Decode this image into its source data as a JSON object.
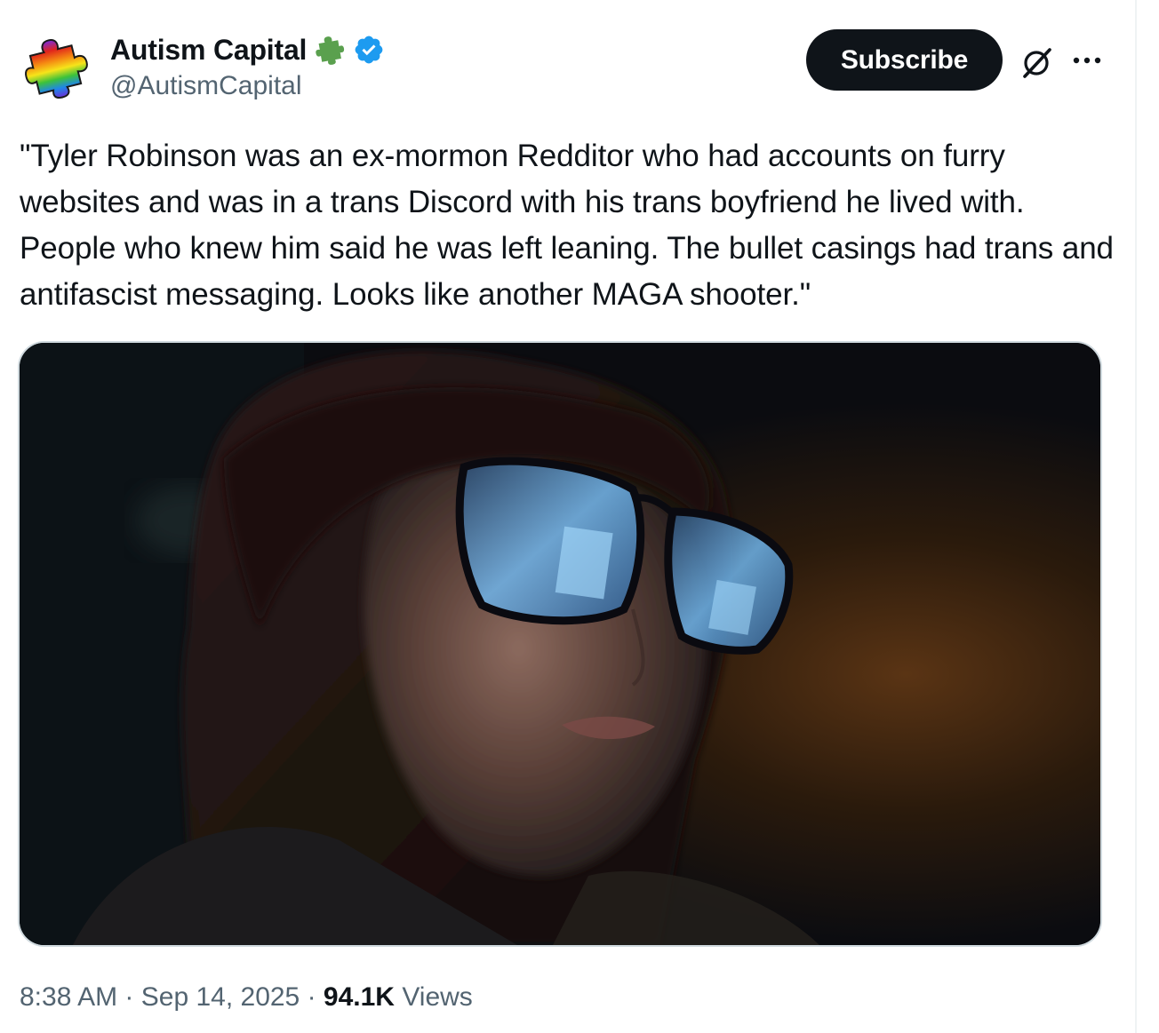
{
  "author": {
    "display_name": "Autism Capital",
    "handle": "@AutismCapital",
    "verified": true,
    "avatar_icon": "rainbow-puzzle-piece-icon",
    "badge_icon": "green-puzzle-piece-icon"
  },
  "actions": {
    "subscribe_label": "Subscribe",
    "grok_icon": "grok-icon",
    "more_icon": "more-options-icon"
  },
  "tweet": {
    "text": "\"Tyler Robinson was an ex-mormon Redditor who had accounts on furry websites and was in a trans Discord with his trans boyfriend he lived with. People who knew him said he was left leaning. The bullet casings had trans and antifascist messaging. Looks like another MAGA shooter.\""
  },
  "meta": {
    "time": "8:38 AM",
    "separator": " · ",
    "date": "Sep 14, 2025",
    "views_count": "94.1K",
    "views_label": " Views"
  },
  "colors": {
    "primary_text": "#0f1419",
    "secondary_text": "#536471",
    "verified_blue": "#1d9bf0",
    "badge_green": "#5aa04e",
    "border": "#cfd9de"
  }
}
